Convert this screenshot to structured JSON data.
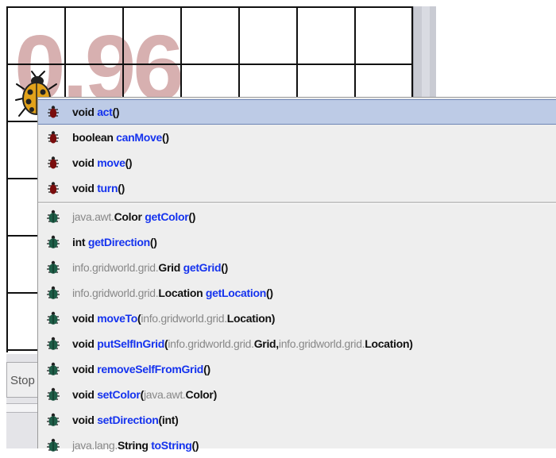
{
  "world": {
    "step_number": "0.96",
    "control": {
      "stop_label": "Stop"
    }
  },
  "menu": {
    "bug_methods": [
      {
        "ret_pkg": "",
        "ret": "void",
        "name": "act",
        "params": "()"
      },
      {
        "ret_pkg": "",
        "ret": "boolean",
        "name": "canMove",
        "params": "()"
      },
      {
        "ret_pkg": "",
        "ret": "void",
        "name": "move",
        "params": "()"
      },
      {
        "ret_pkg": "",
        "ret": "void",
        "name": "turn",
        "params": "()"
      }
    ],
    "actor_methods": [
      {
        "ret_pkg": "java.awt.",
        "ret": "Color",
        "name": "getColor",
        "p_open": "(",
        "p_pkg": "",
        "p_type": "",
        "p_pkg2": "",
        "p_type2": "",
        "p_close": ")"
      },
      {
        "ret_pkg": "",
        "ret": "int",
        "name": "getDirection",
        "p_open": "(",
        "p_pkg": "",
        "p_type": "",
        "p_pkg2": "",
        "p_type2": "",
        "p_close": ")"
      },
      {
        "ret_pkg": "info.gridworld.grid.",
        "ret": "Grid",
        "name": "getGrid",
        "p_open": "(",
        "p_pkg": "",
        "p_type": "",
        "p_pkg2": "",
        "p_type2": "",
        "p_close": ")"
      },
      {
        "ret_pkg": "info.gridworld.grid.",
        "ret": "Location",
        "name": "getLocation",
        "p_open": "(",
        "p_pkg": "",
        "p_type": "",
        "p_pkg2": "",
        "p_type2": "",
        "p_close": ")"
      },
      {
        "ret_pkg": "",
        "ret": "void",
        "name": "moveTo",
        "p_open": "( ",
        "p_pkg": "info.gridworld.grid.",
        "p_type": "Location",
        "p_pkg2": "",
        "p_type2": "",
        "p_close": " )"
      },
      {
        "ret_pkg": "",
        "ret": "void",
        "name": "putSelfInGrid",
        "p_open": "( ",
        "p_pkg": "info.gridworld.grid.",
        "p_type": "Grid, ",
        "p_pkg2": "info.gridworld.grid.",
        "p_type2": "Location",
        "p_close": " )"
      },
      {
        "ret_pkg": "",
        "ret": "void",
        "name": "removeSelfFromGrid",
        "p_open": "(",
        "p_pkg": "",
        "p_type": "",
        "p_pkg2": "",
        "p_type2": "",
        "p_close": ")"
      },
      {
        "ret_pkg": "",
        "ret": "void",
        "name": "setColor",
        "p_open": "( ",
        "p_pkg": "java.awt.",
        "p_type": "Color",
        "p_pkg2": "",
        "p_type2": "",
        "p_close": " )"
      },
      {
        "ret_pkg": "",
        "ret": "void",
        "name": "setDirection",
        "p_open": "( ",
        "p_pkg": "",
        "p_type": "int",
        "p_pkg2": "",
        "p_type2": "",
        "p_close": " )"
      },
      {
        "ret_pkg": "java.lang.",
        "ret": "String",
        "name": "toString",
        "p_open": "(",
        "p_pkg": "",
        "p_type": "",
        "p_pkg2": "",
        "p_type2": "",
        "p_close": ")"
      }
    ],
    "icons": {
      "bug_method": "red-bug-icon",
      "actor_method": "green-bug-icon"
    },
    "colors": {
      "method_name": "#1533ee",
      "package": "#888888",
      "selection": "#bdcbe6"
    }
  }
}
